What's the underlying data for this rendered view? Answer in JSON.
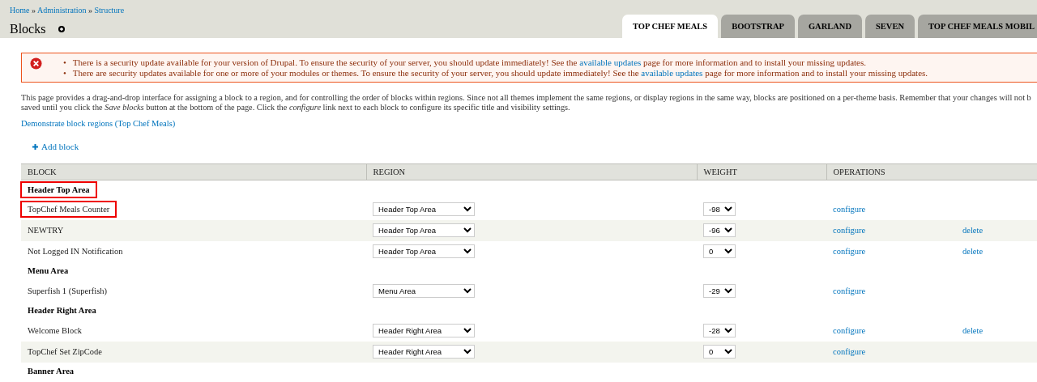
{
  "breadcrumb": [
    {
      "label": "Home"
    },
    {
      "label": "Administration"
    },
    {
      "label": "Structure"
    }
  ],
  "breadcrumb_separator": "»",
  "title": "Blocks",
  "theme_tabs": [
    {
      "label": "TOP CHEF MEALS",
      "selected": true
    },
    {
      "label": "BOOTSTRAP",
      "selected": false
    },
    {
      "label": "GARLAND",
      "selected": false
    },
    {
      "label": "SEVEN",
      "selected": false
    },
    {
      "label": "TOP CHEF MEALS MOBIL",
      "selected": false
    }
  ],
  "message_marker": "•",
  "messages": [
    {
      "before": "There is a security update available for your version of Drupal. To ensure the security of your server, you should update immediately! See the",
      "link": "available updates",
      "after": "page for more information and to install your missing updates."
    },
    {
      "before": "There are security updates available for one or more of your modules or themes. To ensure the security of your server, you should update immediately! See the",
      "link": "available updates",
      "after": "page for more information and to install your missing updates."
    }
  ],
  "description_lines": [
    "This page provides a drag-and-drop interface for assigning a block to a region, and for controlling the order of blocks within regions. Since not all themes implement the same regions, or display regions in the same way, blocks are positioned on a per-theme basis. Remember that your changes will not b",
    "saved until you click the *Save blocks* button at the bottom of the page. Click the *configure* link next to each block to configure its specific title and visibility settings."
  ],
  "demo_link": "Demonstrate block regions (Top Chef Meals)",
  "add_block": "Add block",
  "table": {
    "columns": [
      "BLOCK",
      "REGION",
      "WEIGHT",
      "OPERATIONS"
    ],
    "rows": [
      {
        "kind": "region",
        "name": "Header Top Area",
        "highlighted": true
      },
      {
        "kind": "block",
        "name": "TopChef Meals Counter",
        "highlighted": true,
        "region": "Header Top Area",
        "weight": "-98",
        "configure": "configure"
      },
      {
        "kind": "block",
        "name": "NEWTRY",
        "highlighted": false,
        "region": "Header Top Area",
        "weight": "-96",
        "configure": "configure",
        "delete": "delete"
      },
      {
        "kind": "block",
        "name": "Not Logged IN Notification",
        "highlighted": false,
        "region": "Header Top Area",
        "weight": "0",
        "configure": "configure",
        "delete": "delete"
      },
      {
        "kind": "region",
        "name": "Menu Area",
        "highlighted": false
      },
      {
        "kind": "block",
        "name": "Superfish 1 (Superfish)",
        "highlighted": false,
        "region": "Menu Area",
        "weight": "-29",
        "configure": "configure"
      },
      {
        "kind": "region",
        "name": "Header Right Area",
        "highlighted": false
      },
      {
        "kind": "block",
        "name": "Welcome Block",
        "highlighted": false,
        "region": "Header Right Area",
        "weight": "-28",
        "configure": "configure",
        "delete": "delete"
      },
      {
        "kind": "block",
        "name": "TopChef Set ZipCode",
        "highlighted": false,
        "region": "Header Right Area",
        "weight": "0",
        "configure": "configure"
      },
      {
        "kind": "region",
        "name": "Banner Area",
        "highlighted": false
      }
    ]
  }
}
